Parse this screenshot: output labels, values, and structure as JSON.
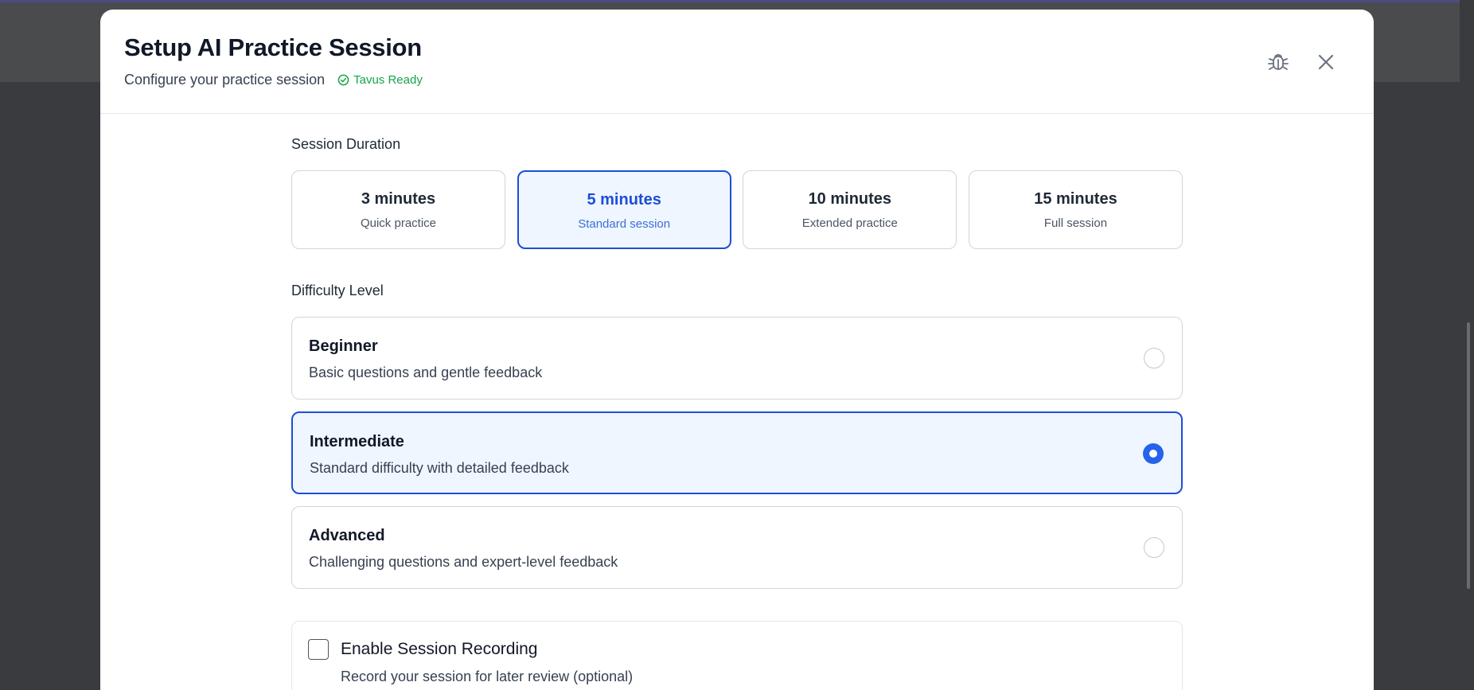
{
  "header": {
    "title": "Setup AI Practice Session",
    "subtitle": "Configure your practice session",
    "status_badge": "Tavus Ready"
  },
  "duration": {
    "label": "Session Duration",
    "options": [
      {
        "title": "3 minutes",
        "subtitle": "Quick practice",
        "selected": false
      },
      {
        "title": "5 minutes",
        "subtitle": "Standard session",
        "selected": true
      },
      {
        "title": "10 minutes",
        "subtitle": "Extended practice",
        "selected": false
      },
      {
        "title": "15 minutes",
        "subtitle": "Full session",
        "selected": false
      }
    ]
  },
  "difficulty": {
    "label": "Difficulty Level",
    "options": [
      {
        "title": "Beginner",
        "description": "Basic questions and gentle feedback",
        "selected": false
      },
      {
        "title": "Intermediate",
        "description": "Standard difficulty with detailed feedback",
        "selected": true
      },
      {
        "title": "Advanced",
        "description": "Challenging questions and expert-level feedback",
        "selected": false
      }
    ]
  },
  "recording": {
    "title": "Enable Session Recording",
    "description": "Record your session for later review (optional)",
    "checked": false
  },
  "colors": {
    "accent": "#1d4ed8",
    "selected_bg": "#eff6ff",
    "ready": "#16a34a"
  },
  "icons": {
    "ready": "check-circle-icon",
    "debug": "bug-icon",
    "close": "close-icon"
  }
}
